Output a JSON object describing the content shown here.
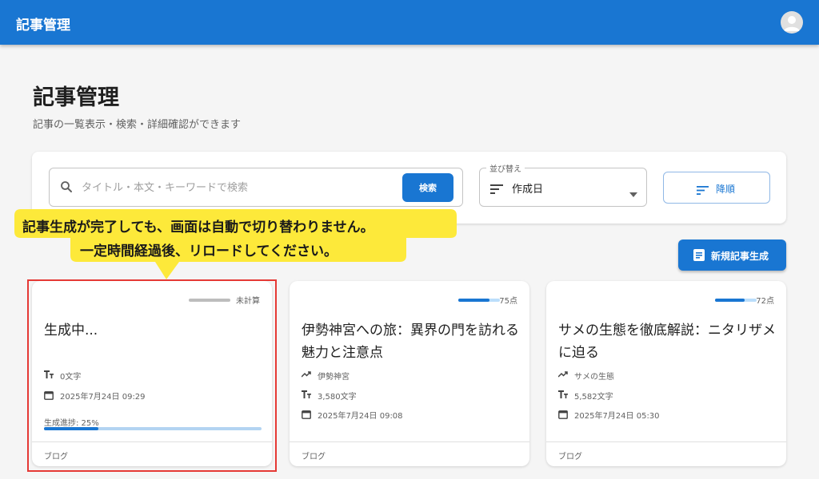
{
  "appbar": {
    "title": "記事管理"
  },
  "page": {
    "title": "記事管理",
    "subtitle": "記事の一覧表示・検索・詳細確認ができます"
  },
  "search": {
    "placeholder": "タイトル・本文・キーワードで検索",
    "value": "",
    "button_label": "検索"
  },
  "sort": {
    "legend": "並び替え",
    "value": "作成日"
  },
  "order": {
    "label": "降順"
  },
  "new_article": {
    "label": "新規記事生成"
  },
  "notice": {
    "line1": "記事生成が完了しても、画面は自動で切り替わりません。",
    "line2": "一定時間経過後、リロードしてください。"
  },
  "cards": [
    {
      "score_text": "未計算",
      "score": null,
      "title": "生成中...",
      "word_count": "0文字",
      "date": "2025年7月24日 09:29",
      "progress_label": "生成進捗: 25%",
      "progress": 0.25,
      "category": "ブログ"
    },
    {
      "score_text": "75点",
      "score": 75,
      "title": "伊勢神宮への旅：異界の門を訪れる魅力と注意点",
      "keyword": "伊勢神宮",
      "word_count": "3,580文字",
      "date": "2025年7月24日 09:08",
      "category": "ブログ"
    },
    {
      "score_text": "72点",
      "score": 72,
      "title": "サメの生態を徹底解説：ニタリザメに迫る",
      "keyword": "サメの生態",
      "word_count": "5,582文字",
      "date": "2025年7月24日 05:30",
      "category": "ブログ"
    }
  ],
  "colors": {
    "primary": "#1976d2",
    "notice_bg": "#fde93a",
    "highlight_border": "#e53935"
  }
}
